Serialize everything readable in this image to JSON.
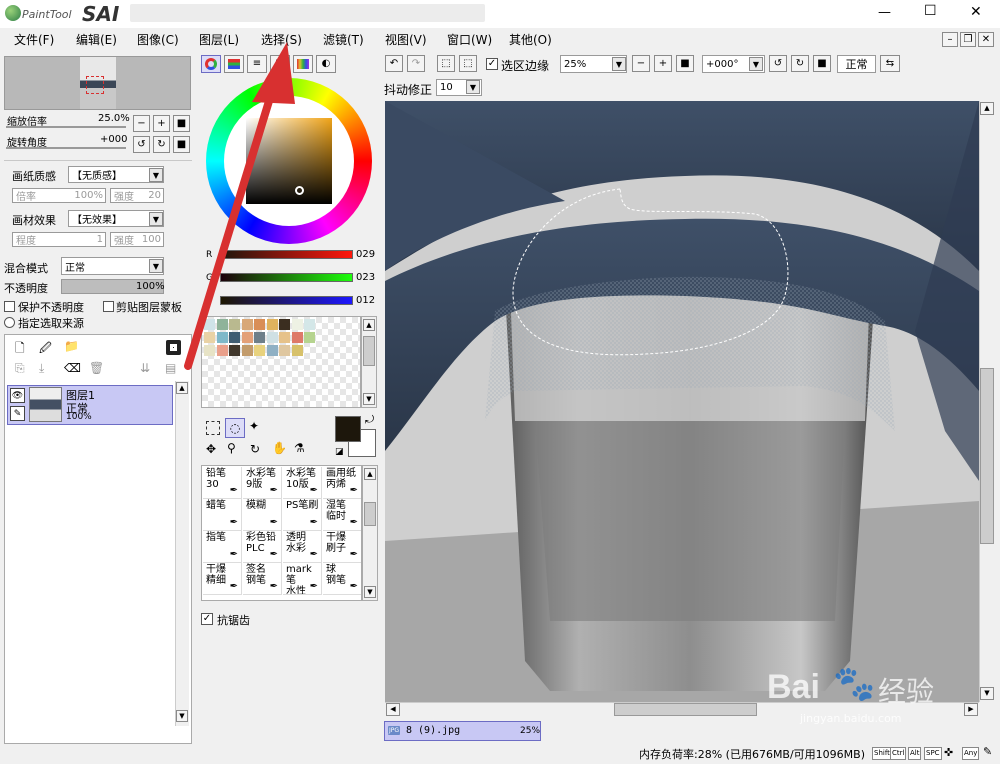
{
  "app": {
    "logo_small": "PaintTool",
    "logo_big": "SAI"
  },
  "window_controls": {
    "minimize": "—",
    "maximize": "☐",
    "close": "✕"
  },
  "menu": [
    {
      "label": "文件(F)"
    },
    {
      "label": "编辑(E)"
    },
    {
      "label": "图像(C)"
    },
    {
      "label": "图层(L)"
    },
    {
      "label": "选择(S)"
    },
    {
      "label": "滤镜(T)"
    },
    {
      "label": "视图(V)"
    },
    {
      "label": "窗口(W)"
    },
    {
      "label": "其他(O)"
    }
  ],
  "navigator": {
    "zoom_label": "缩放倍率",
    "zoom_value": "25.0%",
    "rotate_label": "旋转角度",
    "rotate_value": "+000"
  },
  "paper": {
    "texture_label": "画纸质感",
    "texture_value": "【无质感】",
    "scale_label": "倍率",
    "scale_value": "100%",
    "strength_label": "强度",
    "strength_value": "20",
    "effect_label": "画材效果",
    "effect_value": "【无效果】",
    "degree_label": "程度",
    "degree_value": "1",
    "strength2_label": "强度",
    "strength2_value": "100"
  },
  "blend": {
    "mode_label": "混合模式",
    "mode_value": "正常",
    "opacity_label": "不透明度",
    "opacity_value": "100%",
    "protect_label": "保护不透明度",
    "clip_label": "剪贴图层蒙板",
    "source_label": "指定选取来源"
  },
  "layer": {
    "name": "图层1",
    "mode": "正常",
    "opacity": "100%"
  },
  "color": {
    "r_label": "R",
    "g_label": "G",
    "b_label": "B",
    "r_value": "029",
    "g_value": "023",
    "b_value": "012",
    "primary": "#1d170c",
    "secondary": "#ffffff"
  },
  "swatches": [
    "#cfe3e8",
    "#8fb39a",
    "#b9b98f",
    "#d8a777",
    "#d98e57",
    "#e0b35e",
    "#3b2e20",
    "#eef2e4",
    "#d4e7e8",
    "#e9d2a5",
    "#7fb8c9",
    "#3f5d73",
    "#e3a078",
    "#6e7f89",
    "#cfe0e4",
    "#e6c28a",
    "#de7a6a",
    "#b6d48f",
    "#e7e3c6",
    "#eaa08b",
    "#40372c",
    "#c29b6b",
    "#e8d27e",
    "#8fb0c4",
    "#dfc7a0",
    "#d7c16a"
  ],
  "brushes": [
    {
      "line1": "铅笔",
      "line2": "30"
    },
    {
      "line1": "水彩笔",
      "line2": "9版"
    },
    {
      "line1": "水彩笔",
      "line2": "10版"
    },
    {
      "line1": "画用纸",
      "line2": "丙烯"
    },
    {
      "line1": "蜡笔",
      "line2": ""
    },
    {
      "line1": "模糊",
      "line2": ""
    },
    {
      "line1": "PS笔刷",
      "line2": ""
    },
    {
      "line1": "湿笔",
      "line2": "临时"
    },
    {
      "line1": "指笔",
      "line2": ""
    },
    {
      "line1": "彩色铅",
      "line2": "PLC"
    },
    {
      "line1": "透明",
      "line2": "水彩"
    },
    {
      "line1": "干爆",
      "line2": "刷子"
    },
    {
      "line1": "干爆",
      "line2": "精细"
    },
    {
      "line1": "签名",
      "line2": "钢笔"
    },
    {
      "line1": "mark笔",
      "line2": "水性"
    },
    {
      "line1": "球",
      "line2": "钢笔"
    }
  ],
  "antialias_label": "抗锯齿",
  "toolbar": {
    "selection_edge_label": "选区边缘",
    "zoom_value": "25%",
    "angle_value": "+000°",
    "mode_value": "正常",
    "stabilizer_label": "抖动修正",
    "stabilizer_value": "10"
  },
  "document_tab": {
    "icon": "JPG",
    "name": "8 (9).jpg",
    "zoom": "25%"
  },
  "status": {
    "memory": "内存负荷率:28% (已用676MB/可用1096MB)",
    "keys": [
      "Shift",
      "Ctrl",
      "Alt",
      "SPC",
      "Any"
    ]
  },
  "watermark": {
    "main": "Bai",
    "paw": "🐾",
    "tail": "经验",
    "sub": "jingyan.baidu.com"
  },
  "accent": "#d83030"
}
